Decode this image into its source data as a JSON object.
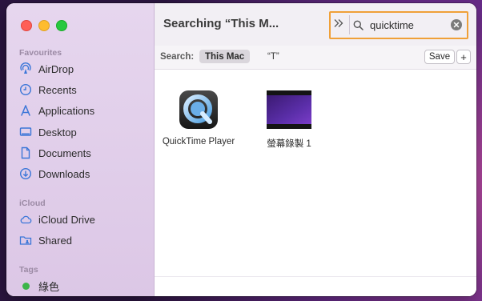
{
  "window": {
    "title": "Searching “This M..."
  },
  "sidebar": {
    "sections": [
      {
        "title": "Favourites"
      },
      {
        "title": "iCloud"
      },
      {
        "title": "Tags"
      }
    ],
    "favourites": [
      {
        "label": "AirDrop",
        "icon": "airdrop-icon"
      },
      {
        "label": "Recents",
        "icon": "clock-icon"
      },
      {
        "label": "Applications",
        "icon": "applications-icon"
      },
      {
        "label": "Desktop",
        "icon": "desktop-icon"
      },
      {
        "label": "Documents",
        "icon": "document-icon"
      },
      {
        "label": "Downloads",
        "icon": "download-icon"
      }
    ],
    "icloud": [
      {
        "label": "iCloud Drive",
        "icon": "cloud-icon"
      },
      {
        "label": "Shared",
        "icon": "shared-folder-icon"
      }
    ],
    "tags": [
      {
        "label": "綠色",
        "color": "#3cb54a"
      }
    ]
  },
  "search": {
    "value": "quicktime"
  },
  "scope": {
    "label": "Search:",
    "selected": "This Mac",
    "other": "“T”",
    "save_label": "Save",
    "add_label": "+"
  },
  "files": [
    {
      "name": "QuickTime Player",
      "icon": "quicktime-app-icon"
    },
    {
      "name": "螢幕錄製 1",
      "icon": "movie-thumbnail-icon"
    }
  ],
  "colors": {
    "accent": "#3478f6",
    "sidebar_icon": "#3a76d8",
    "highlight": "#f0a038"
  }
}
